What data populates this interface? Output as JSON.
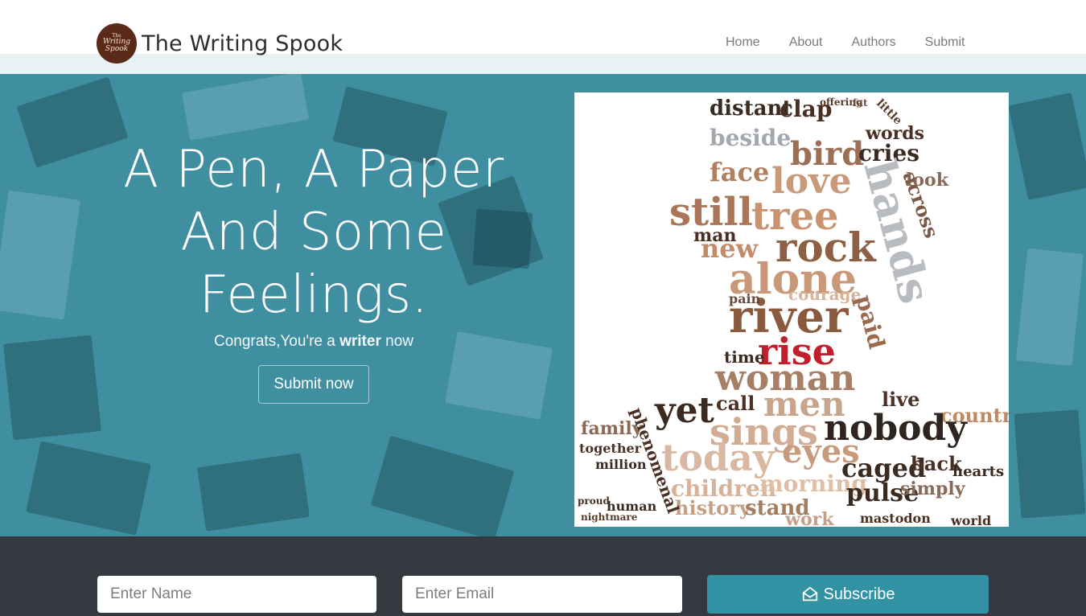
{
  "brand": {
    "name": "The Writing Spook",
    "logo_lines": [
      "The",
      "Writing",
      "Spook"
    ]
  },
  "nav": {
    "items": [
      {
        "label": "Home"
      },
      {
        "label": "About"
      },
      {
        "label": "Authors"
      },
      {
        "label": "Submit"
      }
    ]
  },
  "hero": {
    "headline_lines": [
      "A Pen, A Paper",
      "And Some",
      "Feelings."
    ],
    "sub_prefix": "Congrats,You're a ",
    "sub_bold": "writer",
    "sub_suffix": " now",
    "cta_label": "Submit now"
  },
  "wordcloud": {
    "words": [
      {
        "text": "distant",
        "color": "#3b2a20"
      },
      {
        "text": "clap",
        "color": "#4a2f22"
      },
      {
        "text": "offering",
        "color": "#5a3b2b"
      },
      {
        "text": "fat",
        "color": "#6a4a38"
      },
      {
        "text": "little",
        "color": "#5a3b2b"
      },
      {
        "text": "beside",
        "color": "#a3a8ae"
      },
      {
        "text": "words",
        "color": "#4a2f22"
      },
      {
        "text": "bird",
        "color": "#9a6f56"
      },
      {
        "text": "cries",
        "color": "#3b2a20"
      },
      {
        "text": "face",
        "color": "#b07f5f"
      },
      {
        "text": "love",
        "color": "#c99a7a"
      },
      {
        "text": "look",
        "color": "#8a6a56"
      },
      {
        "text": "still",
        "color": "#a9765a"
      },
      {
        "text": "tree",
        "color": "#c8946f"
      },
      {
        "text": "hands",
        "color": "#b8bcc0"
      },
      {
        "text": "across",
        "color": "#7a5a46"
      },
      {
        "text": "new",
        "color": "#c28c6a"
      },
      {
        "text": "rock",
        "color": "#8d5f44"
      },
      {
        "text": "alone",
        "color": "#c99878"
      },
      {
        "text": "man",
        "color": "#4a2f22"
      },
      {
        "text": "courage",
        "color": "#d6b39a"
      },
      {
        "text": "river",
        "color": "#8a5a3e"
      },
      {
        "text": "paid",
        "color": "#9a6a4c"
      },
      {
        "text": "rise",
        "color": "#c0202c"
      },
      {
        "text": "woman",
        "color": "#a67f66"
      },
      {
        "text": "yet",
        "color": "#3b2a20"
      },
      {
        "text": "men",
        "color": "#c7a48d"
      },
      {
        "text": "live",
        "color": "#4a3226"
      },
      {
        "text": "country",
        "color": "#c08a64"
      },
      {
        "text": "sings",
        "color": "#d1ab92"
      },
      {
        "text": "nobody",
        "color": "#2e2420"
      },
      {
        "text": "today",
        "color": "#d8b8a2"
      },
      {
        "text": "eyes",
        "color": "#c79a7c"
      },
      {
        "text": "caged",
        "color": "#3b2a20"
      },
      {
        "text": "back",
        "color": "#4a2f22"
      },
      {
        "text": "children",
        "color": "#d6b39a"
      },
      {
        "text": "morning",
        "color": "#e0bea6"
      },
      {
        "text": "pulse",
        "color": "#3b2a20"
      },
      {
        "text": "simply",
        "color": "#8a6a56"
      },
      {
        "text": "history",
        "color": "#c89e82"
      },
      {
        "text": "stand",
        "color": "#a27d62"
      },
      {
        "text": "work",
        "color": "#c4a08a"
      },
      {
        "text": "mastodon",
        "color": "#4a2f22"
      },
      {
        "text": "hearts",
        "color": "#3b2a20"
      },
      {
        "text": "world",
        "color": "#4a2f22"
      },
      {
        "text": "million",
        "color": "#3b2a20"
      },
      {
        "text": "family",
        "color": "#8a6a56"
      },
      {
        "text": "together",
        "color": "#4a3226"
      },
      {
        "text": "human",
        "color": "#3b2a20"
      },
      {
        "text": "proud",
        "color": "#4a2f22"
      },
      {
        "text": "nightmare",
        "color": "#5a3b2b"
      },
      {
        "text": "phenomenal",
        "color": "#4a2f22"
      },
      {
        "text": "time",
        "color": "#3b2a20"
      },
      {
        "text": "pain",
        "color": "#6a4a38"
      },
      {
        "text": "call",
        "color": "#4a2f22"
      }
    ]
  },
  "subscribe": {
    "name_placeholder": "Enter Name",
    "email_placeholder": "Enter Email",
    "button_label": "Subscribe",
    "button_icon": "envelope-open-icon",
    "accent": "#3391a4"
  }
}
